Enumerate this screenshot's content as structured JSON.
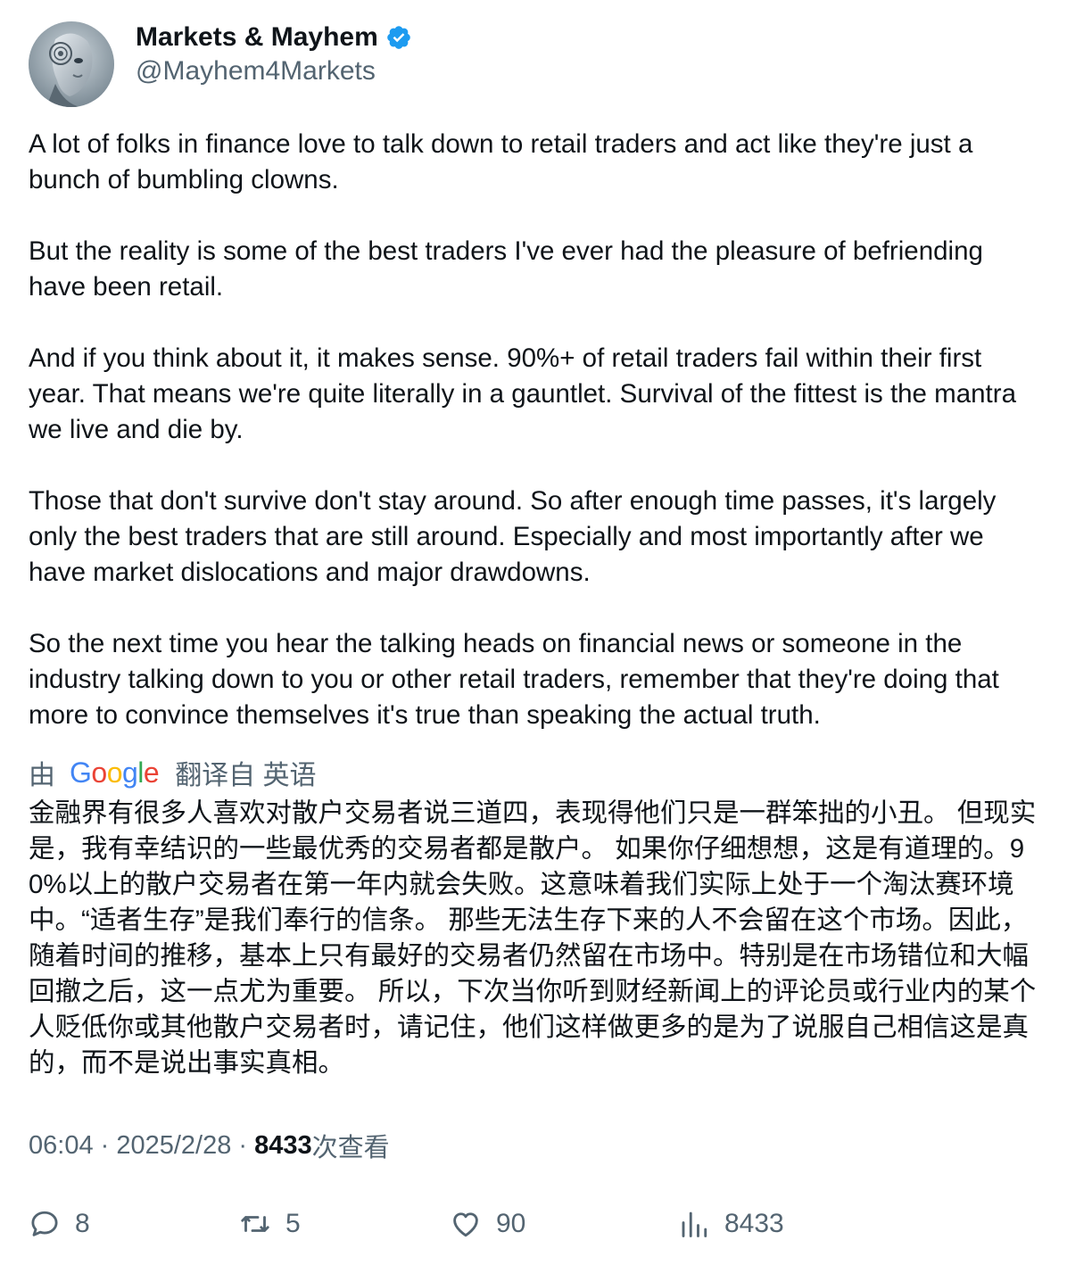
{
  "author": {
    "name": "Markets & Mayhem",
    "handle": "@Mayhem4Markets",
    "verified": true,
    "avatar_icon": "robot-avatar"
  },
  "tweet": {
    "text": "A lot of folks in finance love to talk down to retail traders and act like they're just a bunch of bumbling clowns.\n\nBut the reality is some of the best traders I've ever had the pleasure of befriending have been retail.\n\nAnd if you think about it, it makes sense. 90%+ of retail traders fail within their first year. That means we're quite literally in a gauntlet. Survival of the fittest is the mantra we live and die by.\n\nThose that don't survive don't stay around. So after enough time passes, it's largely only the best traders that are still around. Especially and most importantly after we have market dislocations and major drawdowns.\n\nSo the next time you hear the talking heads on financial news or someone in the industry talking down to you or other retail traders, remember that they're doing that more to convince themselves it's true than speaking the actual truth."
  },
  "translation": {
    "by": "由",
    "provider": "Google",
    "label": "翻译自 英语",
    "text": "金融界有很多人喜欢对散户交易者说三道四，表现得他们只是一群笨拙的小丑。 但现实是，我有幸结识的一些最优秀的交易者都是散户。 如果你仔细想想，这是有道理的。90%以上的散户交易者在第一年内就会失败。这意味着我们实际上处于一个淘汰赛环境中。“适者生存”是我们奉行的信条。 那些无法生存下来的人不会留在这个市场。因此，随着时间的推移，基本上只有最好的交易者仍然留在市场中。特别是在市场错位和大幅回撤之后，这一点尤为重要。 所以，下次当你听到财经新闻上的评论员或行业内的某个人贬低你或其他散户交易者时，请记住，他们这样做更多的是为了说服自己相信这是真的，而不是说出事实真相。"
  },
  "meta": {
    "time": "06:04",
    "sep1": " · ",
    "date": "2025/2/28",
    "sep2": " · ",
    "views": "8433",
    "views_label": "次查看"
  },
  "actions": {
    "replies": "8",
    "retweets": "5",
    "likes": "90",
    "views": "8433"
  },
  "colors": {
    "text": "#0f1419",
    "secondary": "#536471",
    "verified": "#1d9bf0"
  }
}
